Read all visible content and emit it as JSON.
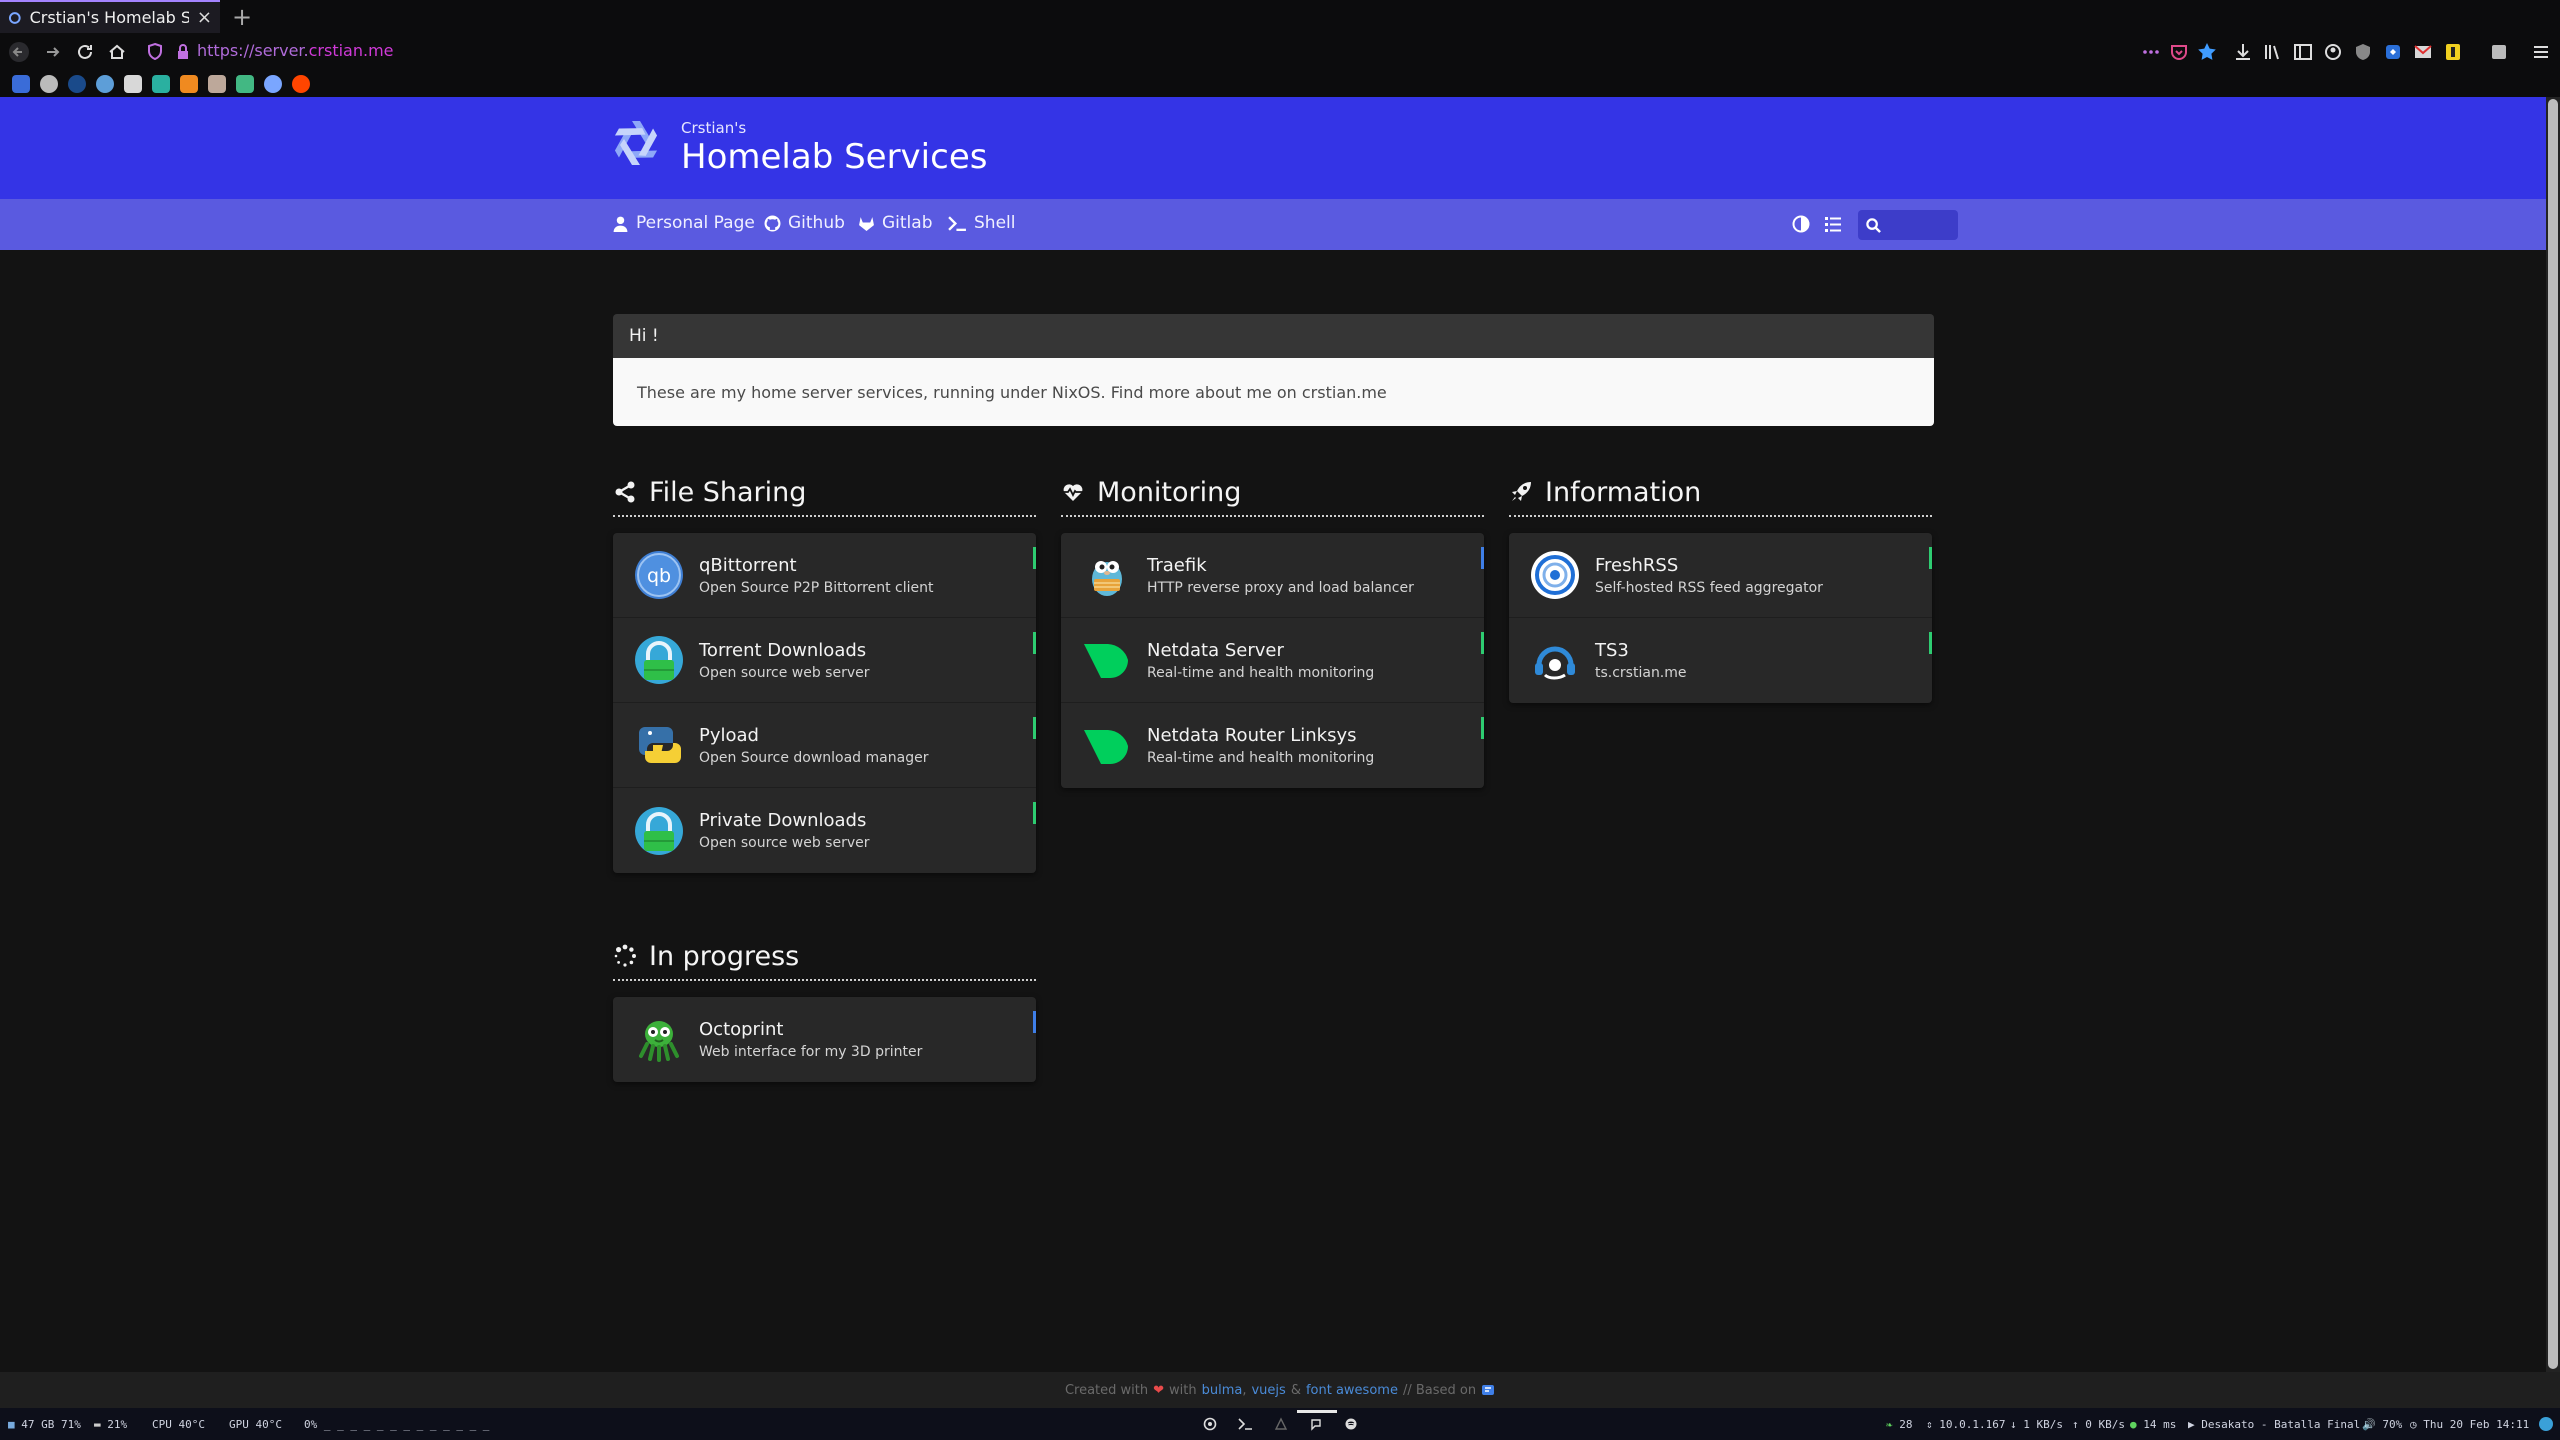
{
  "browser": {
    "tab_title": "Crstian's Homelab Ser",
    "tab_close": "×",
    "new_tab": "+",
    "url_prefix": "https://server.",
    "url_domain": "crstian.me"
  },
  "header": {
    "subtitle": "Crstian's",
    "title": "Homelab Services"
  },
  "navbar": {
    "links": [
      {
        "label": "Personal Page",
        "icon": "user-icon"
      },
      {
        "label": "Github",
        "icon": "github-icon"
      },
      {
        "label": "Gitlab",
        "icon": "gitlab-icon"
      },
      {
        "label": "Shell",
        "icon": "terminal-icon"
      }
    ],
    "search_placeholder": ""
  },
  "message": {
    "title": "Hi !",
    "content": "These are my home server services, running under NixOS. Find more about me on crstian.me"
  },
  "sections": [
    {
      "name": "File Sharing",
      "icon": "share-icon",
      "items": [
        {
          "name": "qBittorrent",
          "subtitle": "Open Source P2P Bittorrent client",
          "logo": "qbittorrent-logo",
          "tag_color": "#2ecc71"
        },
        {
          "name": "Torrent Downloads",
          "subtitle": "Open source web server",
          "logo": "lock-logo",
          "tag_color": "#2ecc71"
        },
        {
          "name": "Pyload",
          "subtitle": "Open Source download manager",
          "logo": "python-logo",
          "tag_color": "#2ecc71"
        },
        {
          "name": "Private Downloads",
          "subtitle": "Open source web server",
          "logo": "lock-logo",
          "tag_color": "#2ecc71"
        }
      ]
    },
    {
      "name": "Monitoring",
      "icon": "heartbeat-icon",
      "items": [
        {
          "name": "Traefik",
          "subtitle": "HTTP reverse proxy and load balancer",
          "logo": "traefik-logo",
          "tag_color": "#3f7fe8"
        },
        {
          "name": "Netdata Server",
          "subtitle": "Real-time and health monitoring",
          "logo": "netdata-logo",
          "tag_color": "#2ecc71"
        },
        {
          "name": "Netdata Router Linksys",
          "subtitle": "Real-time and health monitoring",
          "logo": "netdata-logo",
          "tag_color": "#2ecc71"
        }
      ]
    },
    {
      "name": "Information",
      "icon": "rocket-icon",
      "items": [
        {
          "name": "FreshRSS",
          "subtitle": "Self-hosted RSS feed aggregator",
          "logo": "freshrss-logo",
          "tag_color": "#2ecc71"
        },
        {
          "name": "TS3",
          "subtitle": "ts.crstian.me",
          "logo": "teamspeak-logo",
          "tag_color": "#2ecc71"
        }
      ]
    },
    {
      "name": "In progress",
      "icon": "spinner-icon",
      "items": [
        {
          "name": "Octoprint",
          "subtitle": "Web interface for my 3D printer",
          "logo": "octoprint-logo",
          "tag_color": "#3f7fe8"
        }
      ]
    }
  ],
  "footer": {
    "created": "Created with",
    "with": "with",
    "bulma": "bulma",
    "sep1": ",",
    "vuejs": "vuejs",
    "amp": "&",
    "fontawesome": "font awesome",
    "based": "// Based on"
  },
  "statusbar": {
    "disk": "47 GB 71%",
    "mem": "21%",
    "cpu": "CPU 40°C",
    "gpu": "GPU 40°C",
    "load": "0% _ _ _ _ _ _ _ _ _ _ _ _ _",
    "updates": "28",
    "ip": "10.0.1.167",
    "down": "1 KB/s",
    "up": "0 KB/s",
    "ping": "14 ms",
    "music": "Desakato - Batalla Final",
    "volume": "70%",
    "datetime": "Thu 20 Feb 14:11"
  }
}
